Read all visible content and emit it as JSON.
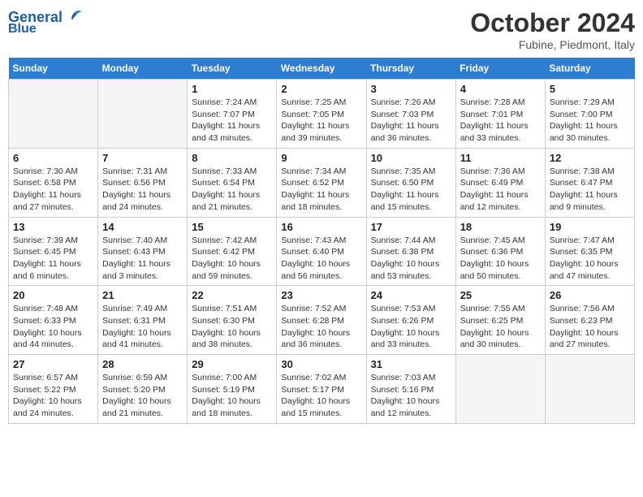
{
  "header": {
    "logo_line1": "General",
    "logo_line2": "Blue",
    "month": "October 2024",
    "location": "Fubine, Piedmont, Italy"
  },
  "days_of_week": [
    "Sunday",
    "Monday",
    "Tuesday",
    "Wednesday",
    "Thursday",
    "Friday",
    "Saturday"
  ],
  "weeks": [
    [
      {
        "num": "",
        "info": ""
      },
      {
        "num": "",
        "info": ""
      },
      {
        "num": "1",
        "info": "Sunrise: 7:24 AM\nSunset: 7:07 PM\nDaylight: 11 hours and 43 minutes."
      },
      {
        "num": "2",
        "info": "Sunrise: 7:25 AM\nSunset: 7:05 PM\nDaylight: 11 hours and 39 minutes."
      },
      {
        "num": "3",
        "info": "Sunrise: 7:26 AM\nSunset: 7:03 PM\nDaylight: 11 hours and 36 minutes."
      },
      {
        "num": "4",
        "info": "Sunrise: 7:28 AM\nSunset: 7:01 PM\nDaylight: 11 hours and 33 minutes."
      },
      {
        "num": "5",
        "info": "Sunrise: 7:29 AM\nSunset: 7:00 PM\nDaylight: 11 hours and 30 minutes."
      }
    ],
    [
      {
        "num": "6",
        "info": "Sunrise: 7:30 AM\nSunset: 6:58 PM\nDaylight: 11 hours and 27 minutes."
      },
      {
        "num": "7",
        "info": "Sunrise: 7:31 AM\nSunset: 6:56 PM\nDaylight: 11 hours and 24 minutes."
      },
      {
        "num": "8",
        "info": "Sunrise: 7:33 AM\nSunset: 6:54 PM\nDaylight: 11 hours and 21 minutes."
      },
      {
        "num": "9",
        "info": "Sunrise: 7:34 AM\nSunset: 6:52 PM\nDaylight: 11 hours and 18 minutes."
      },
      {
        "num": "10",
        "info": "Sunrise: 7:35 AM\nSunset: 6:50 PM\nDaylight: 11 hours and 15 minutes."
      },
      {
        "num": "11",
        "info": "Sunrise: 7:36 AM\nSunset: 6:49 PM\nDaylight: 11 hours and 12 minutes."
      },
      {
        "num": "12",
        "info": "Sunrise: 7:38 AM\nSunset: 6:47 PM\nDaylight: 11 hours and 9 minutes."
      }
    ],
    [
      {
        "num": "13",
        "info": "Sunrise: 7:39 AM\nSunset: 6:45 PM\nDaylight: 11 hours and 6 minutes."
      },
      {
        "num": "14",
        "info": "Sunrise: 7:40 AM\nSunset: 6:43 PM\nDaylight: 11 hours and 3 minutes."
      },
      {
        "num": "15",
        "info": "Sunrise: 7:42 AM\nSunset: 6:42 PM\nDaylight: 10 hours and 59 minutes."
      },
      {
        "num": "16",
        "info": "Sunrise: 7:43 AM\nSunset: 6:40 PM\nDaylight: 10 hours and 56 minutes."
      },
      {
        "num": "17",
        "info": "Sunrise: 7:44 AM\nSunset: 6:38 PM\nDaylight: 10 hours and 53 minutes."
      },
      {
        "num": "18",
        "info": "Sunrise: 7:45 AM\nSunset: 6:36 PM\nDaylight: 10 hours and 50 minutes."
      },
      {
        "num": "19",
        "info": "Sunrise: 7:47 AM\nSunset: 6:35 PM\nDaylight: 10 hours and 47 minutes."
      }
    ],
    [
      {
        "num": "20",
        "info": "Sunrise: 7:48 AM\nSunset: 6:33 PM\nDaylight: 10 hours and 44 minutes."
      },
      {
        "num": "21",
        "info": "Sunrise: 7:49 AM\nSunset: 6:31 PM\nDaylight: 10 hours and 41 minutes."
      },
      {
        "num": "22",
        "info": "Sunrise: 7:51 AM\nSunset: 6:30 PM\nDaylight: 10 hours and 38 minutes."
      },
      {
        "num": "23",
        "info": "Sunrise: 7:52 AM\nSunset: 6:28 PM\nDaylight: 10 hours and 36 minutes."
      },
      {
        "num": "24",
        "info": "Sunrise: 7:53 AM\nSunset: 6:26 PM\nDaylight: 10 hours and 33 minutes."
      },
      {
        "num": "25",
        "info": "Sunrise: 7:55 AM\nSunset: 6:25 PM\nDaylight: 10 hours and 30 minutes."
      },
      {
        "num": "26",
        "info": "Sunrise: 7:56 AM\nSunset: 6:23 PM\nDaylight: 10 hours and 27 minutes."
      }
    ],
    [
      {
        "num": "27",
        "info": "Sunrise: 6:57 AM\nSunset: 5:22 PM\nDaylight: 10 hours and 24 minutes."
      },
      {
        "num": "28",
        "info": "Sunrise: 6:59 AM\nSunset: 5:20 PM\nDaylight: 10 hours and 21 minutes."
      },
      {
        "num": "29",
        "info": "Sunrise: 7:00 AM\nSunset: 5:19 PM\nDaylight: 10 hours and 18 minutes."
      },
      {
        "num": "30",
        "info": "Sunrise: 7:02 AM\nSunset: 5:17 PM\nDaylight: 10 hours and 15 minutes."
      },
      {
        "num": "31",
        "info": "Sunrise: 7:03 AM\nSunset: 5:16 PM\nDaylight: 10 hours and 12 minutes."
      },
      {
        "num": "",
        "info": ""
      },
      {
        "num": "",
        "info": ""
      }
    ]
  ]
}
